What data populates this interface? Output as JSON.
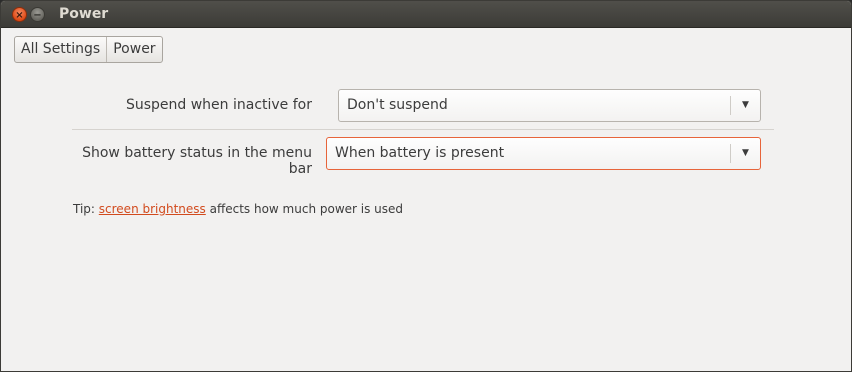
{
  "window": {
    "title": "Power",
    "close_glyph": "×",
    "minimize_glyph": "−"
  },
  "breadcrumb": {
    "items": [
      {
        "label": "All Settings"
      },
      {
        "label": "Power"
      }
    ]
  },
  "settings": {
    "suspend": {
      "label": "Suspend when inactive for",
      "value": "Don't suspend"
    },
    "battery_status": {
      "label": "Show battery status in the menu bar",
      "value": "When battery is present"
    }
  },
  "tip": {
    "prefix": "Tip: ",
    "link": "screen brightness",
    "suffix": " affects how much power is used"
  },
  "icons": {
    "dropdown": "▼"
  },
  "colors": {
    "accent": "#e7643a",
    "link": "#d24b1e",
    "titlebar": "#3c3b37",
    "background": "#f2f1f0"
  }
}
